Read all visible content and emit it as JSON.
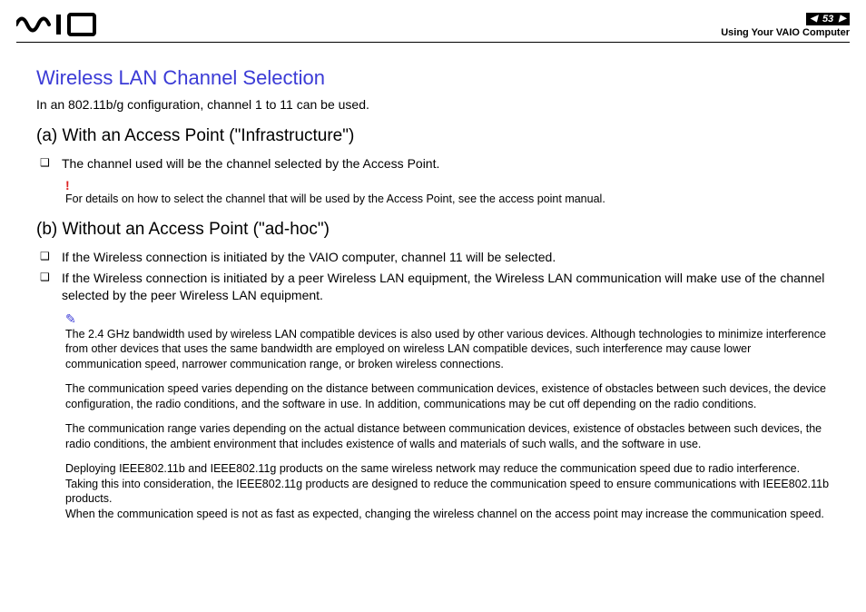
{
  "header": {
    "page_number": "53",
    "section": "Using Your VAIO Computer"
  },
  "title": "Wireless LAN Channel Selection",
  "intro": "In an 802.11b/g configuration, channel 1 to 11 can be used.",
  "section_a": {
    "heading": "(a) With an Access Point (\"Infrastructure\")",
    "bullets": [
      "The channel used will be the channel selected by the Access Point."
    ],
    "note": "For details on how to select the channel that will be used by the Access Point, see the access point manual."
  },
  "section_b": {
    "heading": "(b) Without an Access Point (\"ad-hoc\")",
    "bullets": [
      "If the Wireless connection is initiated by the VAIO computer, channel 11 will be selected.",
      "If the Wireless connection is initiated by a peer Wireless LAN equipment, the Wireless LAN communication will make use of the channel selected by the peer Wireless LAN equipment."
    ],
    "notes": [
      "The 2.4 GHz bandwidth used by wireless LAN compatible devices is also used by other various devices. Although technologies to minimize interference from other devices that uses the same bandwidth are employed on wireless LAN compatible devices, such interference may cause lower communication speed, narrower communication range, or broken wireless connections.",
      "The communication speed varies depending on the distance between communication devices, existence of obstacles between such devices, the device configuration, the radio conditions, and the software in use. In addition, communications may be cut off depending on the radio conditions.",
      "The communication range varies depending on the actual distance between communication devices, existence of obstacles between such devices, the radio conditions, the ambient environment that includes existence of walls and materials of such walls, and the software in use.",
      "Deploying IEEE802.11b and IEEE802.11g products on the same wireless network may reduce the communication speed due to radio interference. Taking this into consideration, the IEEE802.11g products are designed to reduce the communication speed to ensure communications with IEEE802.11b products.",
      "When the communication speed is not as fast as expected, changing the wireless channel on the access point may increase the communication speed."
    ]
  }
}
